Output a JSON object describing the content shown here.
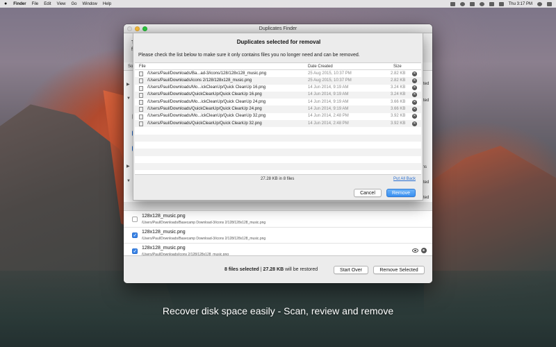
{
  "menubar": {
    "app_name": "Finder",
    "items": [
      "File",
      "Edit",
      "View",
      "Go",
      "Window",
      "Help"
    ],
    "clock": "Thu 3:17 PM"
  },
  "window": {
    "title": "Duplicates Finder",
    "header_line1": "Th",
    "header_line2": "fil",
    "column_stub": "Sor",
    "right_stubs": [
      "cted",
      "cted",
      "ms",
      "cted",
      "cted"
    ],
    "file_rows": [
      {
        "name": "128x128_music.png",
        "path": "/Users/Paul/Downloads/Basecamp Download-3/icons 2/128/128x128_music.png",
        "checked": false
      },
      {
        "name": "128x128_music.png",
        "path": "/Users/Paul/Downloads/Basecamp Download-3/icons 2/128/128x128_music.png",
        "checked": true
      },
      {
        "name": "128x128_music.png",
        "path": "/Users/Paul/Downloads/icons 2/128/128x128_music.png",
        "checked": true
      }
    ],
    "footer": {
      "files_selected": "8 files selected",
      "separator": "|",
      "size": "27.28 KB",
      "restore_text": "will be restored",
      "start_over": "Start Over",
      "remove_selected": "Remove Selected"
    }
  },
  "sheet": {
    "title": "Duplicates selected for removal",
    "subtitle": "Please check the list below to make sure it only contains files you no longer need and can be removed.",
    "columns": {
      "file": "File",
      "date": "Date Created",
      "size": "Size"
    },
    "rows": [
      {
        "path": "/Users/Paul/Downloads/Ba...ad-3/icons/128/128x128_music.png",
        "date": "25 Aug 2015, 10:37 PM",
        "size": "2.82 KB"
      },
      {
        "path": "/Users/Paul/Downloads/icons 2/128/128x128_music.png",
        "date": "25 Aug 2015, 10:37 PM",
        "size": "2.82 KB"
      },
      {
        "path": "/Users/Paul/Downloads/Mo...ickCleanUp/Quick CleanUp 16.png",
        "date": "14 Jun 2014, 9:19 AM",
        "size": "3.24 KB"
      },
      {
        "path": "/Users/Paul/Downloads/QuickCleanUp/Quick CleanUp 16.png",
        "date": "14 Jun 2014, 9:19 AM",
        "size": "3.24 KB"
      },
      {
        "path": "/Users/Paul/Downloads/Mo...ickCleanUp/Quick CleanUp 24.png",
        "date": "14 Jun 2014, 9:19 AM",
        "size": "3.66 KB"
      },
      {
        "path": "/Users/Paul/Downloads/QuickCleanUp/Quick CleanUp 24.png",
        "date": "14 Jun 2014, 9:19 AM",
        "size": "3.66 KB"
      },
      {
        "path": "/Users/Paul/Downloads/Mo...ickCleanUp/Quick CleanUp 32.png",
        "date": "14 Jun 2014, 2:48 PM",
        "size": "3.92 KB"
      },
      {
        "path": "/Users/Paul/Downloads/QuickCleanUp/Quick CleanUp 32.png",
        "date": "14 Jun 2014, 2:48 PM",
        "size": "3.92 KB"
      }
    ],
    "total": "27.28 KB in 8 files",
    "put_all_back": "Put All Back",
    "cancel": "Cancel",
    "remove": "Remove"
  },
  "caption": "Recover disk space easily - Scan, review and remove",
  "colors": {
    "accent": "#3a8ff0",
    "link": "#2a6fd0"
  }
}
